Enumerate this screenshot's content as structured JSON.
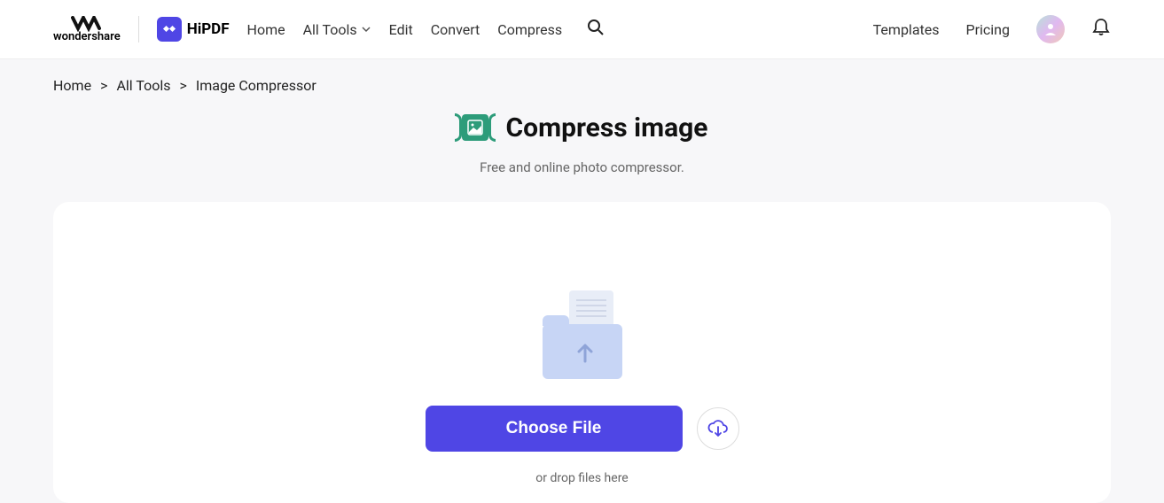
{
  "header": {
    "brand": "wondershare",
    "app": "HiPDF",
    "nav": {
      "home": "Home",
      "alltools": "All Tools",
      "edit": "Edit",
      "convert": "Convert",
      "compress": "Compress"
    },
    "right": {
      "templates": "Templates",
      "pricing": "Pricing"
    }
  },
  "breadcrumb": {
    "home": "Home",
    "alltools": "All Tools",
    "current": "Image Compressor",
    "sep": ">"
  },
  "page": {
    "title": "Compress image",
    "subtitle": "Free and online photo compressor."
  },
  "upload": {
    "choose_label": "Choose File",
    "drop_text": "or drop files here"
  },
  "colors": {
    "primary": "#4F46E5",
    "accent": "#2d9c7a"
  }
}
